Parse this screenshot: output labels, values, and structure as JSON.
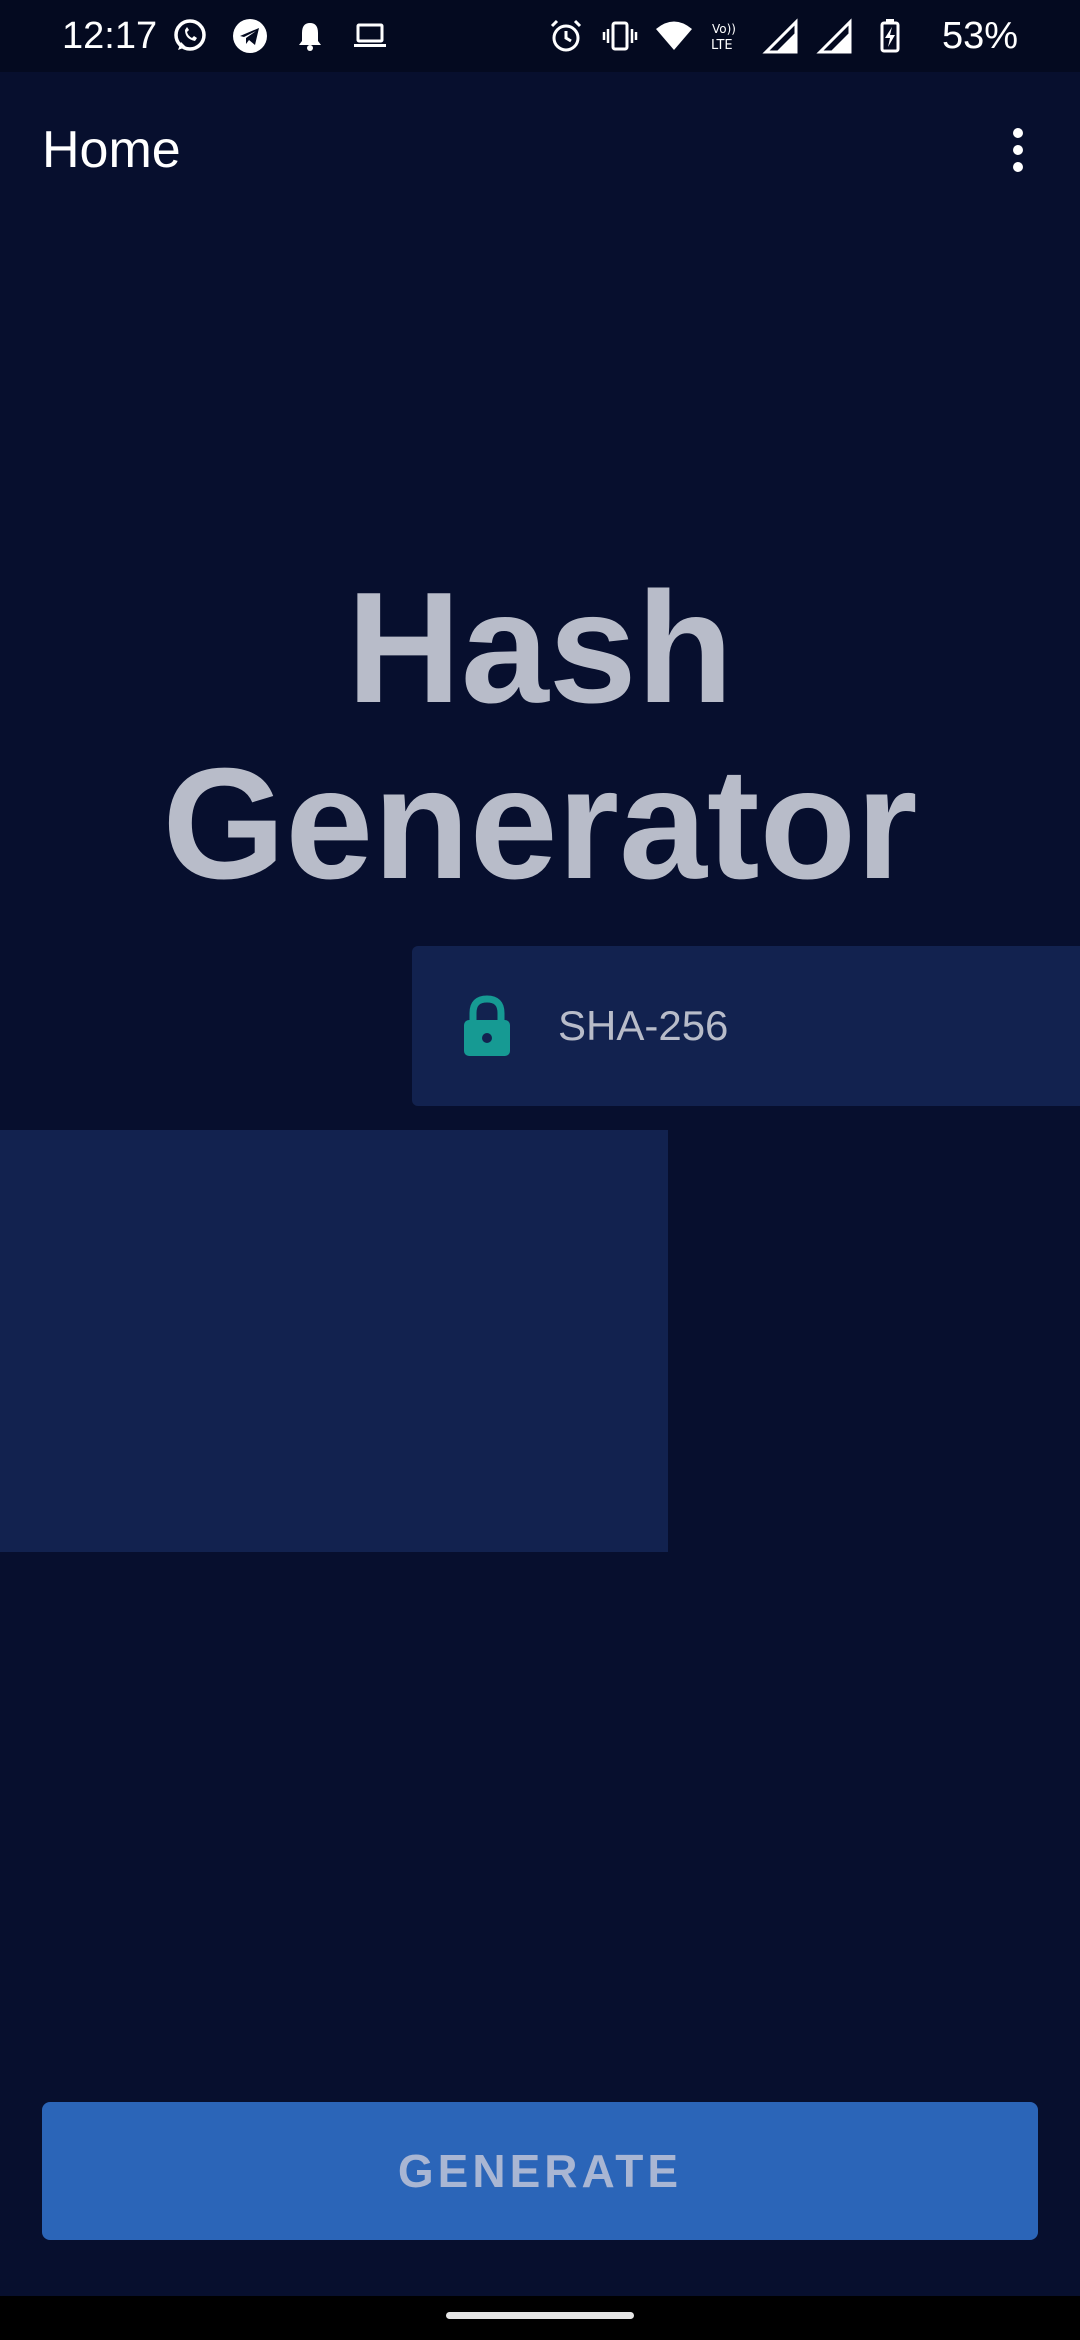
{
  "status_bar": {
    "time": "12:17",
    "battery_percent": "53%",
    "left_icons": [
      "whatsapp-icon",
      "telegram-icon",
      "bell-icon",
      "laptop-icon"
    ],
    "right_icons": [
      "alarm-icon",
      "vibrate-icon",
      "wifi-icon",
      "volte-icon",
      "signal-icon",
      "signal-icon",
      "battery-charging-icon"
    ]
  },
  "app_bar": {
    "title": "Home",
    "menu_icon": "more-vertical-icon"
  },
  "main": {
    "title": "Hash Generator",
    "algorithm": {
      "icon": "lock-icon",
      "label": "SHA-256"
    },
    "input_value": ""
  },
  "actions": {
    "generate_label": "GENERATE"
  },
  "colors": {
    "background": "#070f2e",
    "card": "#12224f",
    "accent": "#2b65b8",
    "lock": "#169a93",
    "title_text": "#b8bcc9"
  }
}
